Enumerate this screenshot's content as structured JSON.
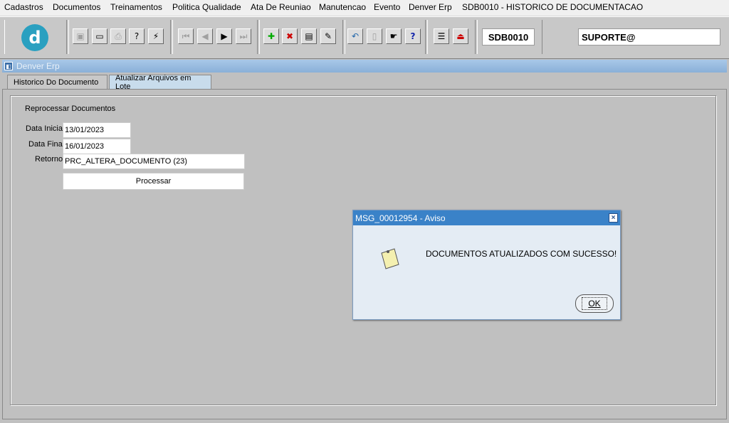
{
  "menu": {
    "items": [
      "Cadastros",
      "Documentos",
      "Treinamentos",
      "Politica Qualidade",
      "Ata De Reuniao",
      "Manutencao",
      "Evento",
      "Denver Erp"
    ],
    "screen_title": "SDB0010 - HISTORICO DE DOCUMENTACAO"
  },
  "toolbar": {
    "logo_letter": "d",
    "form_code": "SDB0010",
    "user": "SUPORTE@"
  },
  "window": {
    "title": "Denver Erp"
  },
  "tabs": [
    {
      "label": "Historico Do Documento"
    },
    {
      "label": "Atualizar Arquivos em Lote"
    }
  ],
  "form": {
    "section_title": "Reprocessar Documentos",
    "data_inicial_label": "Data Inicial",
    "data_inicial_value": "13/01/2023",
    "data_final_label": "Data Final",
    "data_final_value": "16/01/2023",
    "retorno_label": "Retorno",
    "retorno_value": "PRC_ALTERA_DOCUMENTO (23)",
    "process_button": "Processar"
  },
  "dialog": {
    "title": "MSG_00012954 - Aviso",
    "message": "DOCUMENTOS ATUALIZADOS COM SUCESSO!",
    "ok_label": "OK",
    "close_glyph": "×"
  },
  "colors": {
    "dialog_titlebar": "#3a82c8",
    "window_titlebar": "#8ab0d8",
    "active_tab": "#c8dcec"
  }
}
